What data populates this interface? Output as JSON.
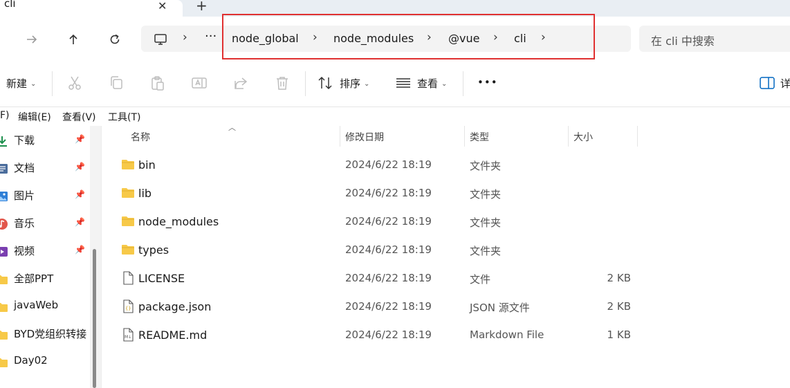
{
  "tab": {
    "title": "cli",
    "close": "✕",
    "new_tab": "+"
  },
  "breadcrumb": {
    "overflow": "···",
    "segments": [
      "node_global",
      "node_modules",
      "@vue",
      "cli"
    ],
    "separator": "›"
  },
  "search": {
    "placeholder": "在 cli 中搜索"
  },
  "toolbar": {
    "new_label": "新建",
    "sort_label": "排序",
    "view_label": "查看",
    "more_label": "•••",
    "details_label": "详"
  },
  "menubar": [
    "F)",
    "编辑(E)",
    "查看(V)",
    "工具(T)"
  ],
  "sidebar": {
    "items": [
      {
        "label": "下载",
        "icon": "download-icon",
        "pinned": true
      },
      {
        "label": "文档",
        "icon": "document-icon",
        "pinned": true
      },
      {
        "label": "图片",
        "icon": "picture-icon",
        "pinned": true
      },
      {
        "label": "音乐",
        "icon": "music-icon",
        "pinned": true
      },
      {
        "label": "视频",
        "icon": "video-icon",
        "pinned": true
      },
      {
        "label": "全部PPT",
        "icon": "folder-icon",
        "pinned": false
      },
      {
        "label": "javaWeb",
        "icon": "folder-icon",
        "pinned": false
      },
      {
        "label": "BYD党组织转接",
        "icon": "folder-icon",
        "pinned": false
      },
      {
        "label": "Day02",
        "icon": "folder-icon",
        "pinned": false
      }
    ]
  },
  "columns": {
    "name": "名称",
    "modified": "修改日期",
    "type": "类型",
    "size": "大小"
  },
  "files": [
    {
      "name": "bin",
      "date": "2024/6/22 18:19",
      "type": "文件夹",
      "size": "",
      "icon": "folder-icon"
    },
    {
      "name": "lib",
      "date": "2024/6/22 18:19",
      "type": "文件夹",
      "size": "",
      "icon": "folder-icon"
    },
    {
      "name": "node_modules",
      "date": "2024/6/22 18:19",
      "type": "文件夹",
      "size": "",
      "icon": "folder-icon"
    },
    {
      "name": "types",
      "date": "2024/6/22 18:19",
      "type": "文件夹",
      "size": "",
      "icon": "folder-icon"
    },
    {
      "name": "LICENSE",
      "date": "2024/6/22 18:19",
      "type": "文件",
      "size": "2 KB",
      "icon": "file-icon"
    },
    {
      "name": "package.json",
      "date": "2024/6/22 18:19",
      "type": "JSON 源文件",
      "size": "2 KB",
      "icon": "json-file-icon"
    },
    {
      "name": "README.md",
      "date": "2024/6/22 18:19",
      "type": "Markdown File",
      "size": "1 KB",
      "icon": "markdown-file-icon"
    }
  ],
  "colors": {
    "folder": "#f7c948",
    "highlight_box": "#e03030",
    "accent": "#0067c0"
  }
}
